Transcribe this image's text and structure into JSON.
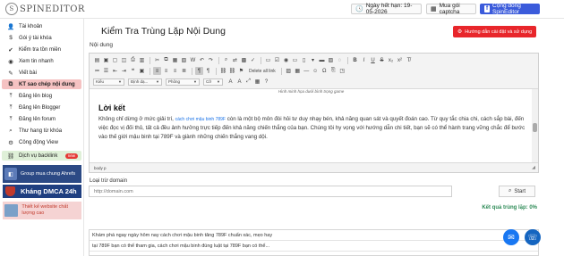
{
  "header": {
    "logo_text": "SPINEDITOR",
    "expiry_label": "Ngày hết hạn: 19-05-2026",
    "captcha_label": "Mua gói captcha",
    "community_label": "Cộng đồng SpinEditor"
  },
  "sidebar": {
    "items": [
      {
        "icon": "user-icon",
        "glyph": "👤",
        "label": "Tài khoản"
      },
      {
        "icon": "dollar-icon",
        "glyph": "$",
        "label": "Gói ý tài khóa"
      },
      {
        "icon": "check-icon",
        "glyph": "✔",
        "label": "Kiểm tra tồn miền"
      },
      {
        "icon": "eye-icon",
        "glyph": "◉",
        "label": "Xem tin nhanh"
      },
      {
        "icon": "pencil-icon",
        "glyph": "✎",
        "label": "Viết bài"
      },
      {
        "icon": "copy-icon",
        "glyph": "⧉",
        "label": "KT sao chép nội dung"
      },
      {
        "icon": "upload-icon",
        "glyph": "⤒",
        "label": "Đăng lên blog"
      },
      {
        "icon": "upload-icon",
        "glyph": "⤒",
        "label": "Đăng lên Blogger"
      },
      {
        "icon": "upload-icon",
        "glyph": "⤒",
        "label": "Đăng lên forum"
      },
      {
        "icon": "search-icon",
        "glyph": "⌕",
        "label": "Thư hang từ khóa"
      },
      {
        "icon": "gear-icon",
        "glyph": "⚙",
        "label": "Công động View"
      },
      {
        "icon": "link-icon",
        "glyph": "⛓",
        "label": "Dịch vụ backlink",
        "badge": "new"
      }
    ],
    "banners": {
      "facebook_group": "Group mua chung Ahrefs",
      "dmca": "Kháng DMCA 24h",
      "web_design": "Thiết kế website chất lượng cao"
    }
  },
  "main": {
    "title": "Kiểm Tra Trùng Lặp Nội Dung",
    "guide_button": "Hướng dẫn cài đặt và sử dụng",
    "content_label": "Nội dung",
    "toolbar": {
      "delete_all": "Delete all link",
      "format_select": "Kiểu",
      "font_select": "Định dạ...",
      "family_select": "Phông",
      "size_select": "Cỡ"
    },
    "editor": {
      "image_caption": "Hình minh họa dưới bình trọng game",
      "heading": "Lời kết",
      "para_1": "Không chỉ dừng ở mức giải trí,",
      "para_link": "cách chơi mậu binh 789F",
      "para_2": "còn là một bộ môn đòi hỏi tư duy nhạy bén, khả năng quan sát và quyết đoán cao. Từ quy tắc chia chi, cách sắp bài, đến việc đọc vị đối thủ, tất cả đều ảnh hưởng trực tiếp đến khả năng chiến thắng của bạn. Chúng tôi hy vọng với hướng dẫn chi tiết, bạn sẽ có thể hành trang vững chắc để bước vào thế giới mậu binh tại 789F và giành những chiến thắng vang dội.",
      "status_path": "body  p"
    },
    "domain": {
      "label": "Loại trừ domain",
      "placeholder": "http://domain.com",
      "start_button": "Start"
    },
    "result_label": "Kết quả trùng lặp: 0%",
    "results": [
      "Khám phá ngay ngày hôm nay cách chơi mậu binh tăng 789F chuẩn xác, mẹo hay",
      "tại 789F bạn có thể tham gia, cách chơi mậu binh đúng luật tại 789F bạn có thể..."
    ]
  }
}
